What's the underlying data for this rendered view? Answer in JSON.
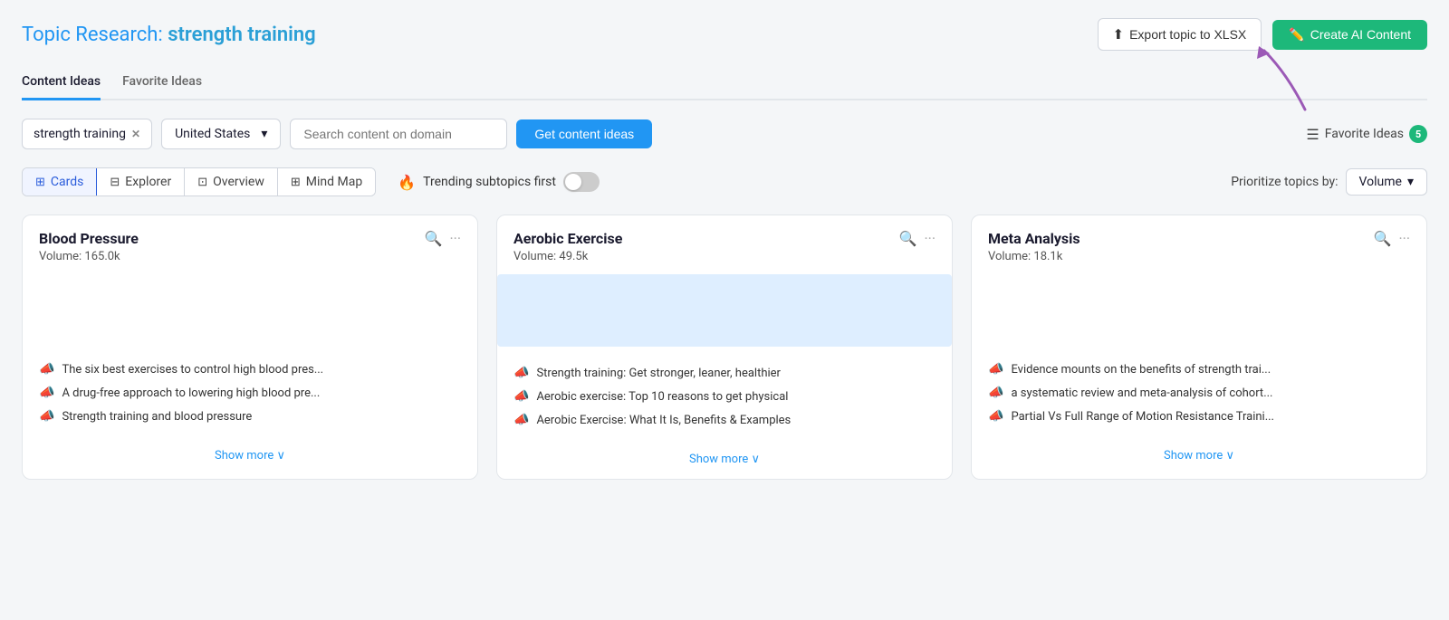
{
  "page": {
    "title_static": "Topic Research:",
    "title_keyword": "strength training"
  },
  "header": {
    "export_label": "Export topic to XLSX",
    "create_ai_label": "Create AI Content"
  },
  "tabs": [
    {
      "id": "content-ideas",
      "label": "Content Ideas",
      "active": true
    },
    {
      "id": "favorite-ideas",
      "label": "Favorite Ideas",
      "active": false
    }
  ],
  "controls": {
    "keyword_value": "strength training",
    "location_value": "United States",
    "domain_placeholder": "Search content on domain",
    "get_ideas_label": "Get content ideas",
    "favorite_ideas_label": "Favorite Ideas",
    "favorite_count": "5"
  },
  "view_switcher": {
    "tabs": [
      {
        "id": "cards",
        "label": "Cards",
        "active": true,
        "icon": "cards-icon"
      },
      {
        "id": "explorer",
        "label": "Explorer",
        "active": false,
        "icon": "table-icon"
      },
      {
        "id": "overview",
        "label": "Overview",
        "active": false,
        "icon": "overview-icon"
      },
      {
        "id": "mind-map",
        "label": "Mind Map",
        "active": false,
        "icon": "mindmap-icon"
      }
    ],
    "trending_label": "Trending subtopics first",
    "trending_enabled": false,
    "prioritize_label": "Prioritize topics by:",
    "prioritize_value": "Volume"
  },
  "cards": [
    {
      "id": "blood-pressure",
      "title": "Blood Pressure",
      "volume": "Volume: 165.0k",
      "has_blue_banner": false,
      "items": [
        "The six best exercises to control high blood pres...",
        "A drug-free approach to lowering high blood pre...",
        "Strength training and blood pressure"
      ],
      "show_more": "Show more ∨"
    },
    {
      "id": "aerobic-exercise",
      "title": "Aerobic Exercise",
      "volume": "Volume: 49.5k",
      "has_blue_banner": true,
      "items": [
        "Strength training: Get stronger, leaner, healthier",
        "Aerobic exercise: Top 10 reasons to get physical",
        "Aerobic Exercise: What It Is, Benefits & Examples"
      ],
      "show_more": "Show more ∨"
    },
    {
      "id": "meta-analysis",
      "title": "Meta Analysis",
      "volume": "Volume: 18.1k",
      "has_blue_banner": false,
      "items": [
        "Evidence mounts on the benefits of strength trai...",
        "a systematic review and meta-analysis of cohort...",
        "Partial Vs Full Range of Motion Resistance Traini..."
      ],
      "show_more": "Show more ∨"
    }
  ]
}
